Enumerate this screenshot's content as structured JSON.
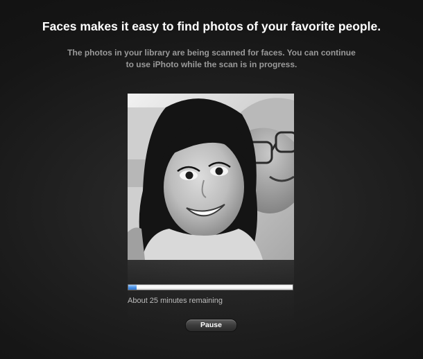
{
  "header": {
    "title": "Faces makes it easy to find photos of your favorite people.",
    "description": "The photos in your library are being scanned for faces. You can continue to use iPhoto while the scan is in progress."
  },
  "scan": {
    "progress_fraction": 0.05,
    "status_text": "About 25 minutes remaining",
    "pause_label": "Pause"
  },
  "colors": {
    "background": "#1c1c1c",
    "headline": "#ffffff",
    "subtext": "#9a9a9a",
    "progress_accent": "#4f95e6"
  },
  "icons": {
    "photo": "photo-thumbnail"
  }
}
